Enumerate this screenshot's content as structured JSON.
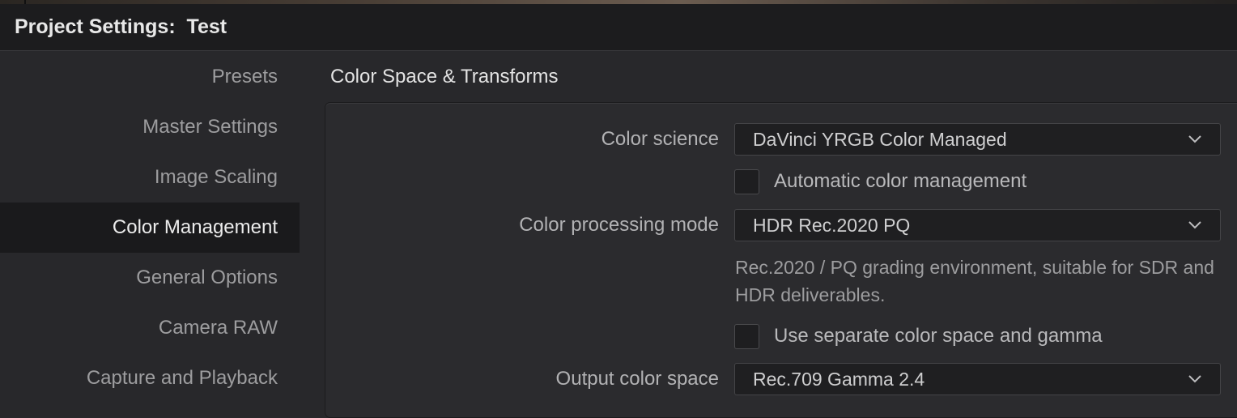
{
  "window": {
    "title": "Project Settings:  Test"
  },
  "sidebar": {
    "items": [
      {
        "label": "Presets"
      },
      {
        "label": "Master Settings"
      },
      {
        "label": "Image Scaling"
      },
      {
        "label": "Color Management",
        "active": true
      },
      {
        "label": "General Options"
      },
      {
        "label": "Camera RAW"
      },
      {
        "label": "Capture and Playback"
      }
    ]
  },
  "main": {
    "section_title": "Color Space & Transforms",
    "color_science": {
      "label": "Color science",
      "value": "DaVinci YRGB Color Managed"
    },
    "auto_color_management": {
      "label": "Automatic color management",
      "checked": false
    },
    "color_processing_mode": {
      "label": "Color processing mode",
      "value": "HDR Rec.2020 PQ",
      "help": "Rec.2020 / PQ grading environment, suitable for SDR and HDR deliverables."
    },
    "separate_color_space_gamma": {
      "label": "Use separate color space and gamma",
      "checked": false
    },
    "output_color_space": {
      "label": "Output color space",
      "value": "Rec.709 Gamma 2.4"
    }
  },
  "icons": {
    "dropdown": "chevron-down-icon"
  },
  "colors": {
    "background": "#28282b",
    "titlebar": "#1c1c1e",
    "active_nav": "#1a1a1c",
    "dropdown_bg": "#1f1f21"
  }
}
